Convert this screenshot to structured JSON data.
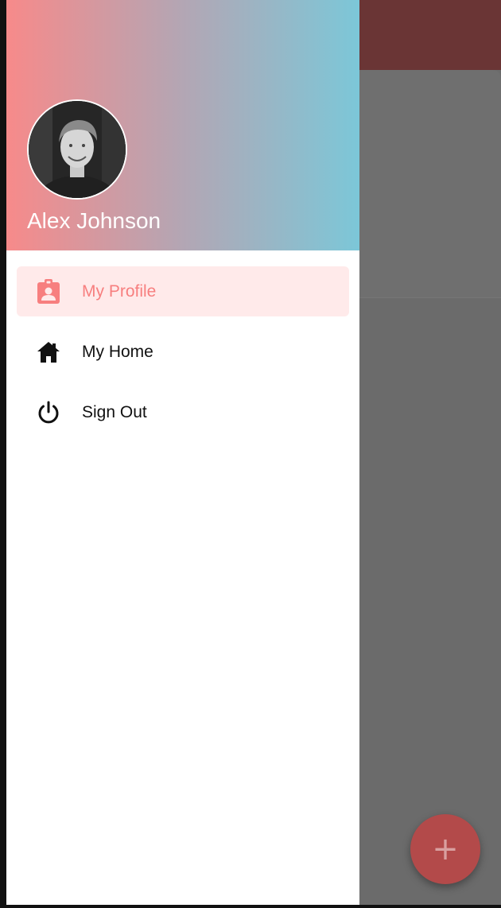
{
  "colors": {
    "accent": "#f77f7f",
    "active_bg": "#ffeaea",
    "header_gradient_start": "#f78a8a",
    "header_gradient_end": "#7cc7d8",
    "background_app_bar": "#6a3535",
    "fab": "#b34a4a"
  },
  "drawer": {
    "header": {
      "avatar_icon": "user-avatar-photo",
      "user_name": "Alex Johnson"
    },
    "items": [
      {
        "label": "My Profile",
        "icon": "profile-badge-icon",
        "active": true
      },
      {
        "label": "My Home",
        "icon": "home-icon",
        "active": false
      },
      {
        "label": "Sign Out",
        "icon": "power-icon",
        "active": false
      }
    ]
  },
  "background": {
    "fab_label": "+",
    "fab_icon": "add-icon"
  }
}
